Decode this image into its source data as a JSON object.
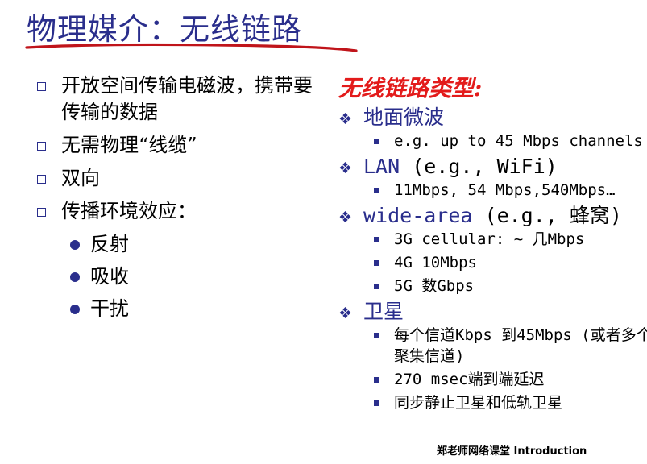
{
  "title": "物理媒介：无线链路",
  "left_items": [
    {
      "text": "开放空间传输电磁波，携带要传输的数据"
    },
    {
      "text": "无需物理“线缆”"
    },
    {
      "text": "双向"
    },
    {
      "text": "传播环境效应："
    }
  ],
  "left_subitems": [
    "反射",
    "吸收",
    "干扰"
  ],
  "right": {
    "heading": "无线链路类型:",
    "groups": [
      {
        "label": "地面微波",
        "suffix": "",
        "subs": [
          "e.g. up to 45 Mbps channels"
        ]
      },
      {
        "label": "LAN",
        "suffix": " (e.g., WiFi)",
        "subs": [
          "11Mbps, 54 Mbps,540Mbps…"
        ]
      },
      {
        "label": "wide-area",
        "suffix": " (e.g., 蜂窝)",
        "subs": [
          "3G cellular: ~ 几Mbps",
          "4G 10Mbps",
          "5G 数Gbps"
        ]
      },
      {
        "label": "卫星",
        "suffix": "",
        "subs": [
          "每个信道Kbps 到45Mbps (或者多个聚集信道)",
          "270 msec端到端延迟",
          "同步静止卫星和低轨卫星"
        ]
      }
    ]
  },
  "footer": "郑老师网络课堂 Introduction",
  "colors": {
    "accent": "#2a2e8c",
    "heading": "#e31b1b",
    "underline": "#c0141a"
  }
}
